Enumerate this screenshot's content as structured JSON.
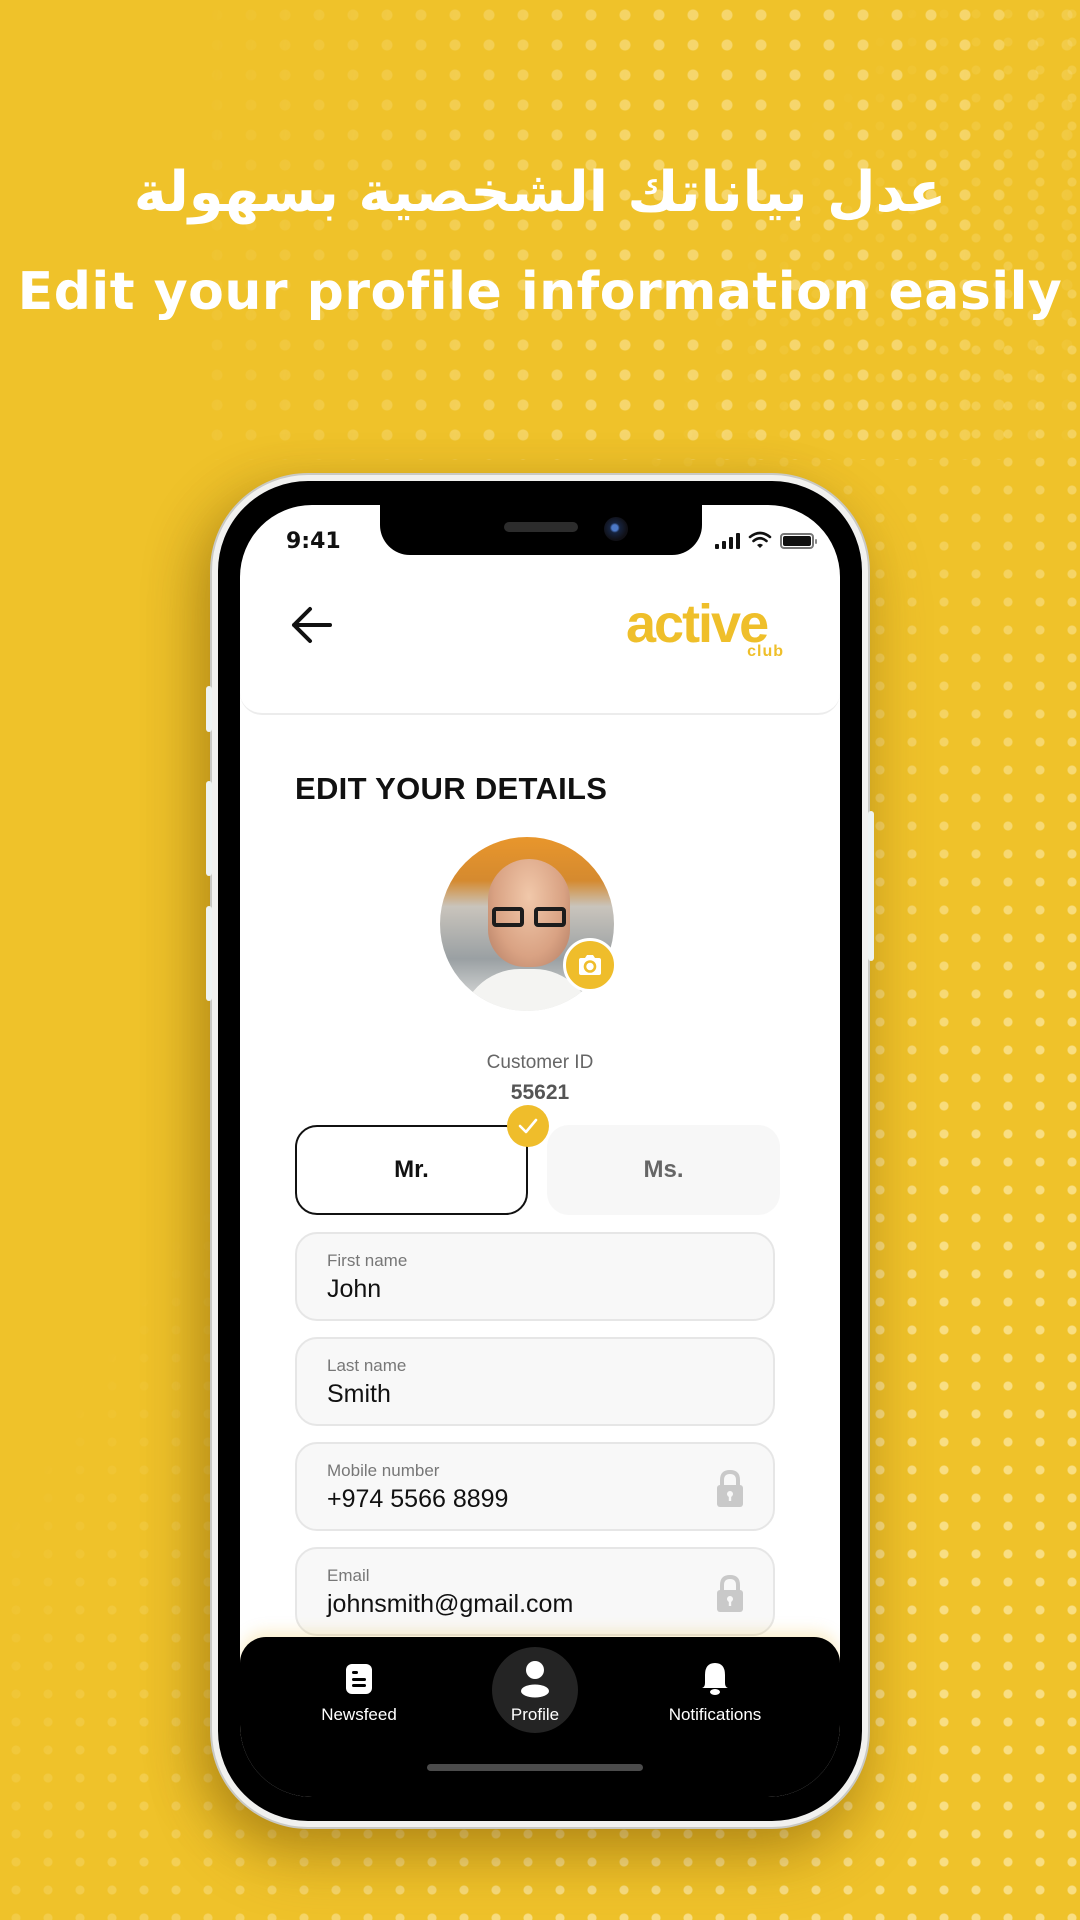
{
  "promo": {
    "headline_ar": "عدل بياناتك الشخصية بسهولة",
    "headline_en": "Edit your profile information easily"
  },
  "colors": {
    "background": "#efc22a",
    "brand_yellow": "#efbd2b",
    "text_dark": "#111111"
  },
  "status_bar": {
    "time": "9:41",
    "icons": [
      "cellular-signal-icon",
      "wifi-icon",
      "battery-icon"
    ]
  },
  "header": {
    "back_icon": "arrow-left-icon",
    "logo_word": "active",
    "logo_sub": "club"
  },
  "profile": {
    "title": "EDIT YOUR DETAILS",
    "avatar_alt": "Profile photo",
    "camera_icon": "camera-icon",
    "customer_id_label": "Customer ID",
    "customer_id": "55621"
  },
  "salutation": {
    "options": [
      {
        "label": "Mr.",
        "selected": true
      },
      {
        "label": "Ms.",
        "selected": false
      }
    ]
  },
  "fields": [
    {
      "label": "First name",
      "value": "John",
      "locked": false
    },
    {
      "label": "Last name",
      "value": "Smith",
      "locked": false
    },
    {
      "label": "Mobile number",
      "value": "+974 5566 8899",
      "locked": true
    },
    {
      "label": "Email",
      "value": "johnsmith@gmail.com",
      "locked": true
    }
  ],
  "bottom_nav": {
    "items": [
      {
        "label": "Newsfeed",
        "icon": "newsfeed-icon",
        "active": false
      },
      {
        "label": "Profile",
        "icon": "profile-icon",
        "active": true
      },
      {
        "label": "Notifications",
        "icon": "bell-icon",
        "active": false
      }
    ]
  }
}
